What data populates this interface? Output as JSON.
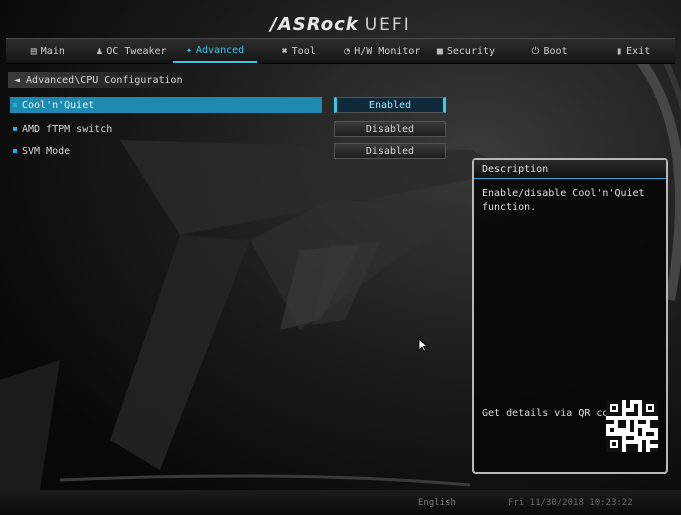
{
  "title": {
    "brand": "/ASRock",
    "product": "UEFI"
  },
  "menubar": {
    "tabs": [
      {
        "icon": "main-icon",
        "glyph": "▤",
        "label": "Main",
        "active": false
      },
      {
        "icon": "oc-tweaker-icon",
        "glyph": "♟",
        "label": "OC Tweaker",
        "active": false
      },
      {
        "icon": "advanced-icon",
        "glyph": "✦",
        "label": "Advanced",
        "active": true
      },
      {
        "icon": "tool-icon",
        "glyph": "✖",
        "label": "Tool",
        "active": false
      },
      {
        "icon": "hw-monitor-icon",
        "glyph": "◔",
        "label": "H/W Monitor",
        "active": false
      },
      {
        "icon": "security-icon",
        "glyph": "■",
        "label": "Security",
        "active": false
      },
      {
        "icon": "boot-icon",
        "glyph": "⏻",
        "label": "Boot",
        "active": false
      },
      {
        "icon": "exit-icon",
        "glyph": "▮",
        "label": "Exit",
        "active": false
      }
    ]
  },
  "breadcrumb": {
    "arrow": "◄",
    "label": "Advanced\\CPU Configuration"
  },
  "settings": [
    {
      "label": "Cool'n'Quiet",
      "value": "Enabled",
      "selected": true
    },
    {
      "label": "AMD fTPM switch",
      "value": "Disabled",
      "selected": false
    },
    {
      "label": "SVM Mode",
      "value": "Disabled",
      "selected": false
    }
  ],
  "description": {
    "heading": "Description",
    "text": "Enable/disable Cool'n'Quiet function.",
    "qr_label": "Get details via QR code"
  },
  "footer": {
    "language": "English",
    "datetime": "Fri 11/30/2018  10:23:22"
  },
  "colors": {
    "accent": "#38c8e8",
    "selected_row": "#1f8ab0"
  }
}
